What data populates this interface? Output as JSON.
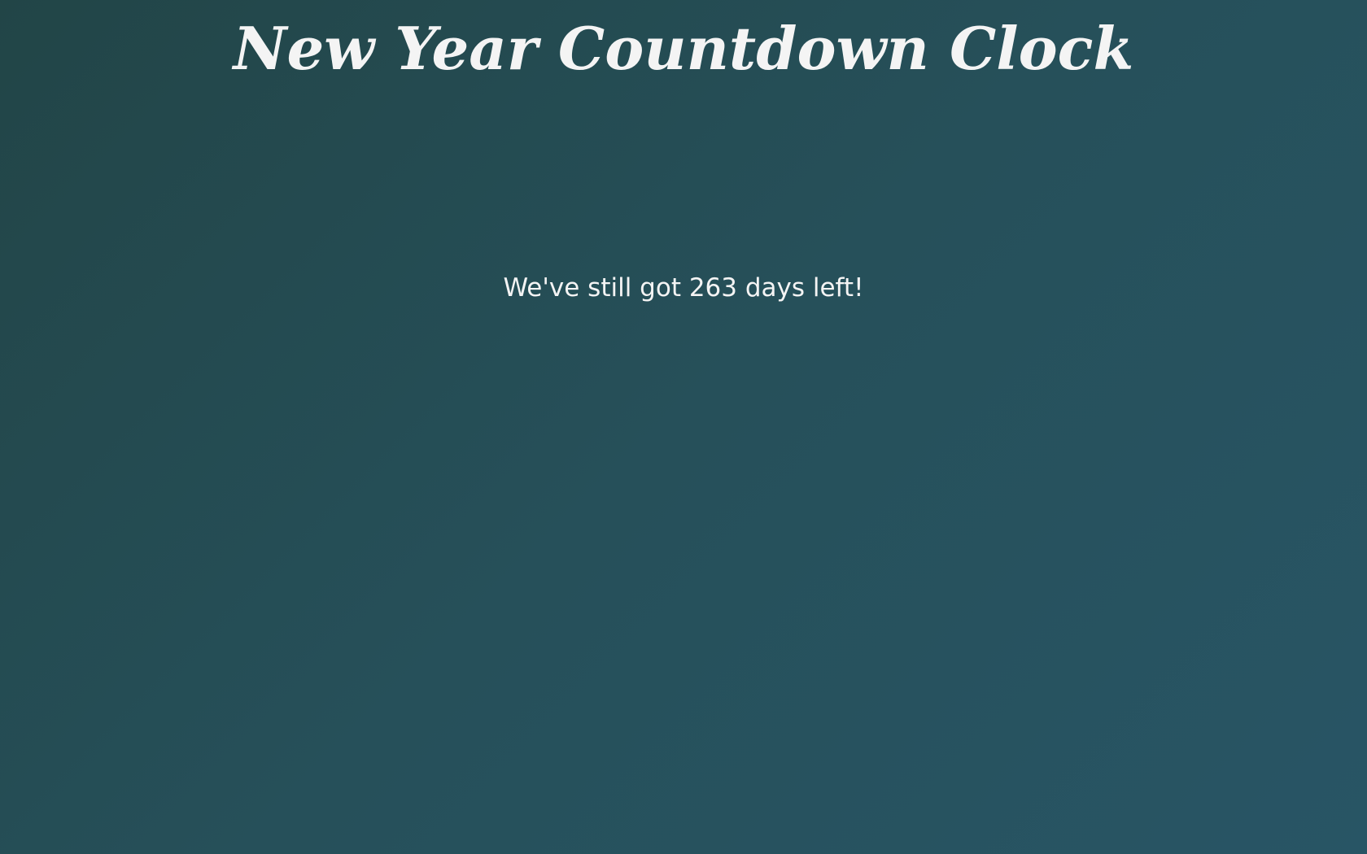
{
  "page": {
    "title": "New Year Countdown Clock",
    "message": "We've still got 263 days left!"
  },
  "colors": {
    "background_start": "#224547",
    "background_end": "#285565",
    "text": "#f4f4f4"
  }
}
